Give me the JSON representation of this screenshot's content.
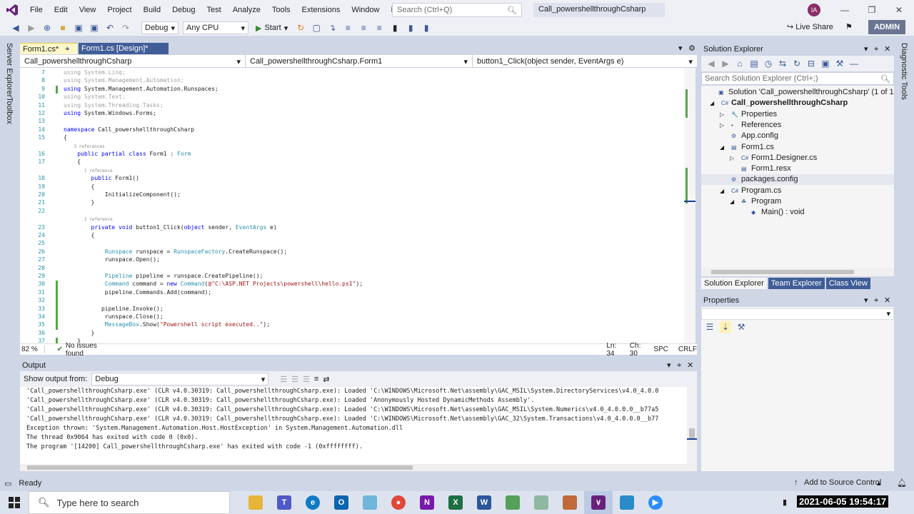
{
  "window": {
    "title": "Call_powershellthroughCsharp",
    "avatar_initials": "IA",
    "admin_label": "ADMIN",
    "live_share_label": "Live Share"
  },
  "menu": [
    "File",
    "Edit",
    "View",
    "Project",
    "Build",
    "Debug",
    "Test",
    "Analyze",
    "Tools",
    "Extensions",
    "Window",
    "Help"
  ],
  "search": {
    "placeholder": "Search (Ctrl+Q)"
  },
  "toolbar": {
    "config": "Debug",
    "platform": "Any CPU",
    "start_label": "Start"
  },
  "side_left": [
    "Server Explorer",
    "Toolbox"
  ],
  "side_right": [
    "Diagnostic Tools"
  ],
  "editor": {
    "tabs": [
      {
        "label": "Form1.cs*"
      },
      {
        "label": "Form1.cs [Design]*"
      }
    ],
    "nav": [
      "Call_powershellthroughCsharp",
      "Call_powershellthroughCsharp.Form1",
      "button1_Click(object sender, EventArgs e)"
    ],
    "lines": [
      {
        "n": "7",
        "t": "using System.Linq;"
      },
      {
        "n": "8",
        "t": "using System.Management.Automation;"
      },
      {
        "n": "9",
        "t": "using System.Management.Automation.Runspaces;"
      },
      {
        "n": "10",
        "t": "using System.Text;"
      },
      {
        "n": "11",
        "t": "using System.Threading.Tasks;"
      },
      {
        "n": "12",
        "t": "using System.Windows.Forms;"
      },
      {
        "n": "13",
        "t": ""
      },
      {
        "n": "14",
        "t": "namespace Call_powershellthroughCsharp"
      },
      {
        "n": "15",
        "t": "{"
      },
      {
        "n": "",
        "t": "    3 references"
      },
      {
        "n": "16",
        "t": "    public partial class Form1 : Form"
      },
      {
        "n": "17",
        "t": "    {"
      },
      {
        "n": "",
        "t": "        1 reference"
      },
      {
        "n": "18",
        "t": "        public Form1()"
      },
      {
        "n": "19",
        "t": "        {"
      },
      {
        "n": "20",
        "t": "            InitializeComponent();"
      },
      {
        "n": "21",
        "t": "        }"
      },
      {
        "n": "22",
        "t": ""
      },
      {
        "n": "",
        "t": "        1 reference"
      },
      {
        "n": "23",
        "t": "        private void button1_Click(object sender, EventArgs e)"
      },
      {
        "n": "24",
        "t": "        {"
      },
      {
        "n": "25",
        "t": ""
      },
      {
        "n": "26",
        "t": "            Runspace runspace = RunspaceFactory.CreateRunspace();"
      },
      {
        "n": "27",
        "t": "            runspace.Open();"
      },
      {
        "n": "28",
        "t": ""
      },
      {
        "n": "29",
        "t": "            Pipeline pipeline = runspace.CreatePipeline();"
      },
      {
        "n": "30",
        "t": "            Command command = new Command(@\"C:\\ASP.NET Projects\\powershell\\hello.ps1\");"
      },
      {
        "n": "31",
        "t": "            pipeline.Commands.Add(command);"
      },
      {
        "n": "32",
        "t": ""
      },
      {
        "n": "33",
        "t": "           pipeline.Invoke();"
      },
      {
        "n": "34",
        "t": "            runspace.Close();"
      },
      {
        "n": "35",
        "t": "            MessageBox.Show(\"Powershell script executed..\");"
      },
      {
        "n": "36",
        "t": "        }"
      },
      {
        "n": "37",
        "t": "    }"
      }
    ],
    "status": {
      "zoom": "82 %",
      "issues": "No issues found",
      "ln": "Ln: 34",
      "ch": "Ch: 30",
      "spc": "SPC",
      "crlf": "CRLF"
    }
  },
  "output": {
    "title": "Output",
    "show_from_label": "Show output from:",
    "source": "Debug",
    "lines": [
      "'Call_powershellthroughCsharp.exe' (CLR v4.0.30319: Call_powershellthroughCsharp.exe): Loaded 'C:\\WINDOWS\\Microsoft.Net\\assembly\\GAC_MSIL\\System.DirectoryServices\\v4.0_4.0.0",
      "'Call_powershellthroughCsharp.exe' (CLR v4.0.30319: Call_powershellthroughCsharp.exe): Loaded 'Anonymously Hosted DynamicMethods Assembly'.",
      "'Call_powershellthroughCsharp.exe' (CLR v4.0.30319: Call_powershellthroughCsharp.exe): Loaded 'C:\\WINDOWS\\Microsoft.Net\\assembly\\GAC_MSIL\\System.Numerics\\v4.0_4.0.0.0__b77a5",
      "'Call_powershellthroughCsharp.exe' (CLR v4.0.30319: Call_powershellthroughCsharp.exe): Loaded 'C:\\WINDOWS\\Microsoft.Net\\assembly\\GAC_32\\System.Transactions\\v4.0_4.0.0.0__b77",
      "Exception thrown: 'System.Management.Automation.Host.HostException' in System.Management.Automation.dll",
      "The thread 0x9064 has exited with code 0 (0x0).",
      "The program '[14200] Call_powershellthroughCsharp.exe' has exited with code -1 (0xffffffff)."
    ]
  },
  "solution_explorer": {
    "title": "Solution Explorer",
    "search_placeholder": "Search Solution Explorer (Ctrl+;)",
    "tree": [
      {
        "label": "Solution 'Call_powershellthroughCsharp' (1 of 1 project)",
        "bold": false,
        "icon": "▣"
      },
      {
        "label": "Call_powershellthroughCsharp",
        "bold": true,
        "icon": "C#"
      },
      {
        "label": "Properties",
        "bold": false,
        "icon": "🔧"
      },
      {
        "label": "References",
        "bold": false,
        "icon": "▪"
      },
      {
        "label": "App.config",
        "bold": false,
        "icon": "⚙"
      },
      {
        "label": "Form1.cs",
        "bold": false,
        "icon": "▤"
      },
      {
        "label": "Form1.Designer.cs",
        "bold": false,
        "icon": "C#"
      },
      {
        "label": "Form1.resx",
        "bold": false,
        "icon": "▤"
      },
      {
        "label": "packages.config",
        "bold": false,
        "icon": "⚙"
      },
      {
        "label": "Program.cs",
        "bold": false,
        "icon": "C#"
      },
      {
        "label": "Program",
        "bold": false,
        "icon": "☘"
      },
      {
        "label": "Main() : void",
        "bold": false,
        "icon": "◆"
      }
    ],
    "tabs": [
      "Solution Explorer",
      "Team Explorer",
      "Class View"
    ]
  },
  "properties": {
    "title": "Properties"
  },
  "statusbar": {
    "ready": "Ready",
    "source_control": "Add to Source Control"
  },
  "taskbar": {
    "search_placeholder": "Type here to search",
    "clock": "2021-06-05 19:54:17"
  }
}
